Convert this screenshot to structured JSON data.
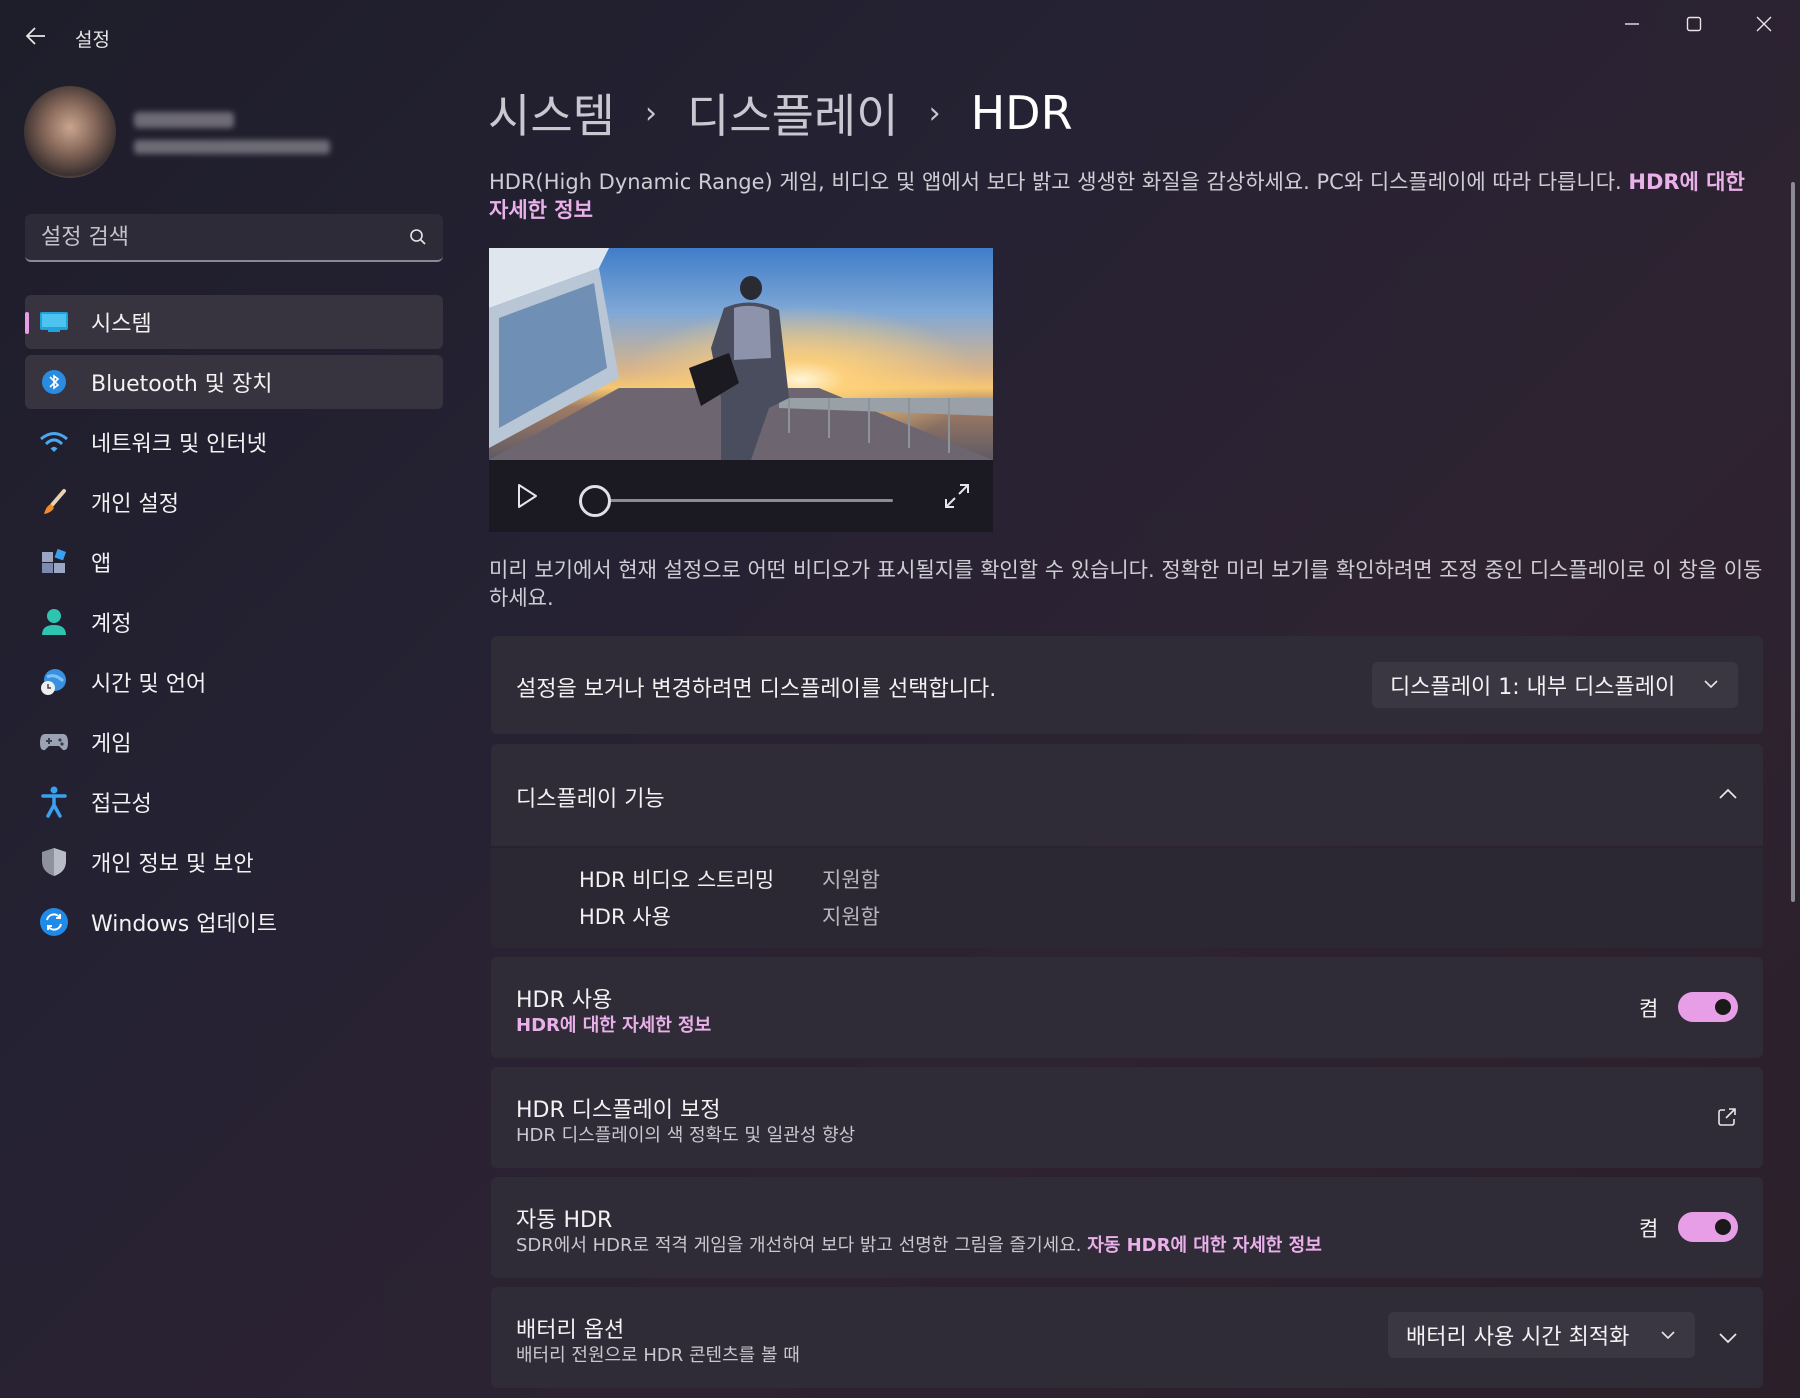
{
  "window": {
    "title": "설정"
  },
  "profile": {
    "name": "",
    "email": ""
  },
  "search": {
    "placeholder": "설정 검색"
  },
  "sidebar": {
    "items": [
      {
        "label": "시스템",
        "icon": "system-display-icon",
        "active": true
      },
      {
        "label": "Bluetooth 및 장치",
        "icon": "bluetooth-icon"
      },
      {
        "label": "네트워크 및 인터넷",
        "icon": "wifi-icon"
      },
      {
        "label": "개인 설정",
        "icon": "paintbrush-icon"
      },
      {
        "label": "앱",
        "icon": "apps-icon"
      },
      {
        "label": "계정",
        "icon": "account-icon"
      },
      {
        "label": "시간 및 언어",
        "icon": "time-language-icon"
      },
      {
        "label": "게임",
        "icon": "gamepad-icon"
      },
      {
        "label": "접근성",
        "icon": "accessibility-icon"
      },
      {
        "label": "개인 정보 및 보안",
        "icon": "shield-icon"
      },
      {
        "label": "Windows 업데이트",
        "icon": "windows-update-icon"
      }
    ]
  },
  "breadcrumb": {
    "parent1": "시스템",
    "parent2": "디스플레이",
    "current": "HDR",
    "separator": "›"
  },
  "intro": {
    "text": "HDR(High Dynamic Range) 게임, 비디오 및 앱에서 보다 밝고 생생한 화질을 감상하세요. PC와 디스플레이에 따라 다릅니다. ",
    "link": "HDR에 대한 자세한 정보"
  },
  "video": {
    "progress": 0
  },
  "preview_note": "미리 보기에서 현재 설정으로 어떤 비디오가 표시될지를 확인할 수 있습니다. 정확한 미리 보기를 확인하려면 조정 중인 디스플레이로 이 창을 이동하세요.",
  "display_select": {
    "label": "설정을 보거나 변경하려면 디스플레이를 선택합니다.",
    "selected": "디스플레이 1: 내부 디스플레이"
  },
  "capabilities": {
    "title": "디스플레이 기능",
    "expanded": true,
    "rows": [
      {
        "label": "HDR 비디오 스트리밍",
        "value": "지원함"
      },
      {
        "label": "HDR 사용",
        "value": "지원함"
      }
    ]
  },
  "use_hdr": {
    "title": "HDR 사용",
    "link": "HDR에 대한 자세한 정보",
    "state_label": "켬",
    "on": true
  },
  "calibration": {
    "title": "HDR 디스플레이 보정",
    "subtitle": "HDR 디스플레이의 색 정확도 및 일관성 향상"
  },
  "auto_hdr": {
    "title": "자동 HDR",
    "subtitle": "SDR에서 HDR로 적격 게임을 개선하여 보다 밝고 선명한 그림을 즐기세요.",
    "link": "자동 HDR에 대한 자세한 정보",
    "state_label": "켬",
    "on": true
  },
  "battery": {
    "title": "배터리 옵션",
    "subtitle": "배터리 전원으로 HDR 콘텐츠를 볼 때",
    "selected": "배터리 사용 시간 최적화"
  },
  "colors": {
    "accent": "#e79ee6",
    "card": "#2f2b37",
    "link": "#eab0ea"
  }
}
